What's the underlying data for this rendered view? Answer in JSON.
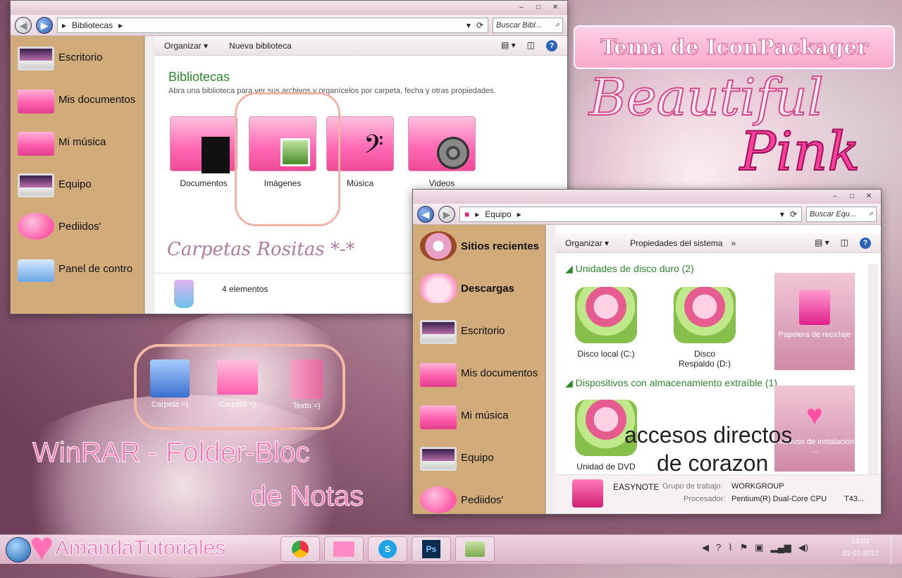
{
  "window1": {
    "breadcrumb": "Bibliotecas",
    "search_placeholder": "Buscar Bibl...",
    "toolbar": {
      "organize": "Organizar",
      "new_library": "Nueva biblioteca"
    },
    "heading": "Bibliotecas",
    "subheading": "Abra una biblioteca para ver sus archivos y organícelos por carpeta, fecha y otras propiedades.",
    "sidebar": [
      "Escritorio",
      "Mis documentos",
      "Mi música",
      "Equipo",
      "Pediidos'",
      "Panel de contro"
    ],
    "folders": [
      "Documentos",
      "Imágenes",
      "Música",
      "Videos"
    ],
    "status": "4 elementos",
    "overlay_caption": "Carpetas Rositas *-*"
  },
  "window2": {
    "breadcrumb": "Equipo",
    "search_placeholder": "Buscar Equ...",
    "toolbar": {
      "organize": "Organizar",
      "system_props": "Propiedades del sistema",
      "more": "»"
    },
    "sidebar": [
      "Sitios recientes",
      "Descargas",
      "Escritorio",
      "Mis documentos",
      "Mi música",
      "Equipo",
      "Pediidos'"
    ],
    "section_hdd": "Unidades de disco duro (2)",
    "section_removable": "Dispositivos con almacenamiento extraíble (1)",
    "drives": [
      "Disco local (C:)",
      "Disco Respaldo (D:)"
    ],
    "dvd": "Unidad de DVD",
    "recycle": "Papelera de reciclaje",
    "install": "Archivos de instalación ...",
    "details": {
      "name": "EASYNOTE",
      "group_label": "Grupo de trabajo:",
      "group": "WORKGROUP",
      "proc_label": "Procesador:",
      "proc": "Pentium(R) Dual-Core CPU",
      "model": "T43..."
    }
  },
  "overlay": {
    "title_box": "Tema de IconPackager",
    "beautiful": "Beautiful",
    "pink": "Pink",
    "accesos": "accesos directos",
    "corazon": "de corazon",
    "winrar": "WinRAR - Folder-Bloc",
    "notas": "de Notas",
    "desk_items": [
      "Carpeta =)",
      "Carpeta =)",
      "Texto =)"
    ]
  },
  "taskbar": {
    "brand": "AmandaTutoriales",
    "time": "13:03",
    "date": "21-07-2012",
    "apps": [
      "chrome-icon",
      "folder-icon",
      "skype-icon",
      "photoshop-icon",
      "notes-icon"
    ]
  },
  "colors": {
    "accent_pink": "#ff5fae",
    "sidebar_tan": "#d1ab7a",
    "heading_green": "#2c8a2c"
  }
}
